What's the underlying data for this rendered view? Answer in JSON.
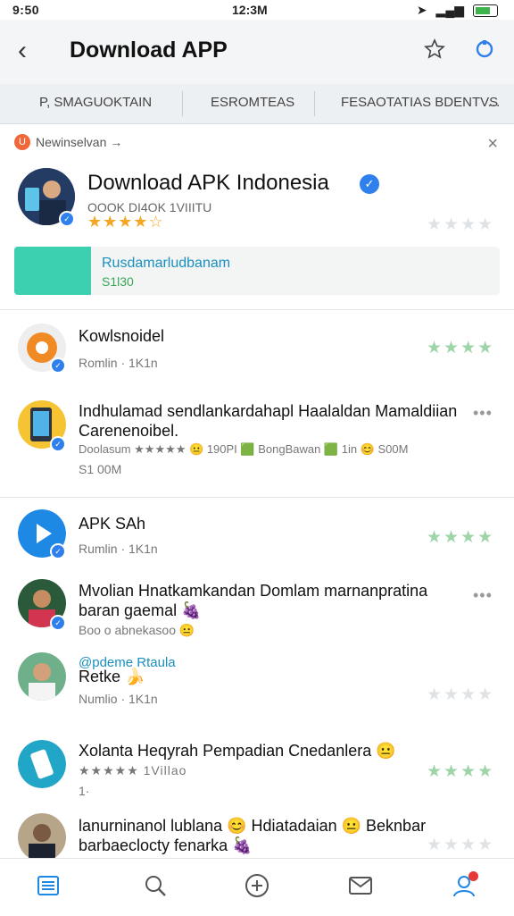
{
  "status": {
    "time_left": "9:50",
    "time_center": "12:3M"
  },
  "header": {
    "back": "‹",
    "title": "Download APP"
  },
  "tabs": [
    "P, SMAGUOKTAIN",
    "ESROMTEAS",
    "FESAOTATIAS BDENTVS"
  ],
  "tab_more": "…",
  "banner": {
    "crumb": "Newinselvan →",
    "close": "×",
    "name": "Download APK Indonesia",
    "sub": "OOOK DI4OK 1VIIITU",
    "stars": "★★★★☆",
    "promo_line1": "Rusdamarludbanam",
    "promo_line2": "S1l30"
  },
  "rows": [
    {
      "name": "Kowlsnoidel",
      "sub": "Romlin · 1K1n"
    },
    {
      "name": "Indhulamad sendlankardahapl Haalaldan Mamaldiian",
      "name2": "Carenenoibel.",
      "sub": "Doolasum ★★★★★ 😐 190PI 🟩 BongBawan 🟩 1in 😊 S00M",
      "sub2": "S1 00M"
    },
    {
      "name": "APK SAh",
      "sub": "Rumlin · 1K1n"
    },
    {
      "name": "Mvolian Hnatkamkandan Domlam marnanpratina",
      "name2": "baran gaemal 🍇",
      "sub": "Boo o abnekasoo 😐"
    },
    {
      "name": "Retke 🍌",
      "tag": "@pdeme Rtaula",
      "sub": "Numlio · 1K1n"
    },
    {
      "name": "Xolanta Heqyrah Pempadian Cnedanlera 😐",
      "sub": "★★★★★ 1Villao",
      "sub2": "1·"
    },
    {
      "name": "lanurninanol lublana 😊 Hdiatadaian 😐 Beknbar",
      "name2": "barbaeclocty fenarka 🍇",
      "sub": ""
    }
  ],
  "rating_stars": "★★★★",
  "more_dots": "•••",
  "colors": {
    "accent": "#2f80ed",
    "promo": "#3ccfb0",
    "star_yellow": "#f5a623",
    "star_green": "#9dd4a8",
    "notification": "#e53935"
  },
  "icons": [
    "back-icon",
    "star-icon",
    "refresh-icon",
    "list-icon",
    "search-icon",
    "add-icon",
    "mail-icon",
    "profile-icon"
  ]
}
